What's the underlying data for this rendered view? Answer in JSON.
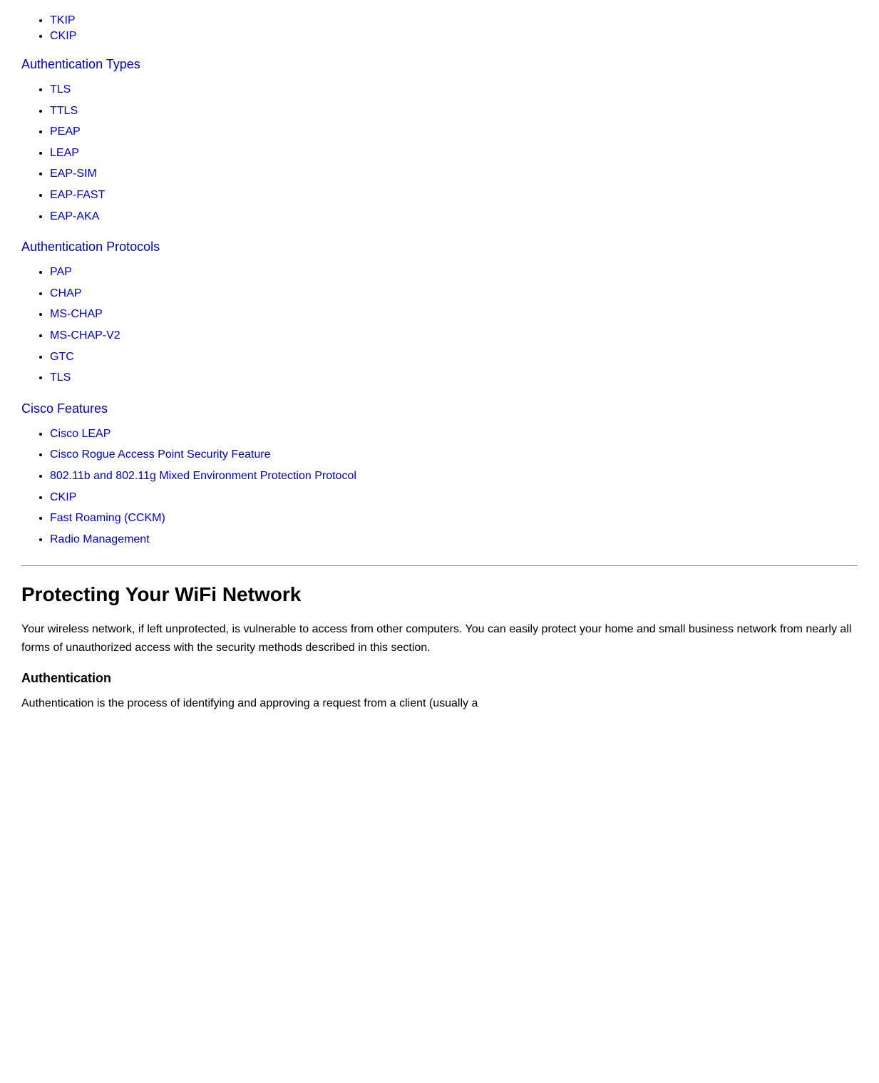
{
  "top_list": {
    "items": [
      {
        "label": "TKIP",
        "href": "#"
      },
      {
        "label": "CKIP",
        "href": "#"
      }
    ]
  },
  "sections": [
    {
      "heading": "Authentication Types",
      "heading_href": "#",
      "items": [
        {
          "label": "TLS",
          "href": "#"
        },
        {
          "label": "TTLS",
          "href": "#"
        },
        {
          "label": "PEAP",
          "href": "#"
        },
        {
          "label": "LEAP",
          "href": "#"
        },
        {
          "label": "EAP-SIM",
          "href": "#"
        },
        {
          "label": "EAP-FAST",
          "href": "#"
        },
        {
          "label": "EAP-AKA",
          "href": "#"
        }
      ]
    },
    {
      "heading": "Authentication Protocols",
      "heading_href": "#",
      "items": [
        {
          "label": "PAP",
          "href": "#"
        },
        {
          "label": "CHAP",
          "href": "#"
        },
        {
          "label": "MS-CHAP",
          "href": "#"
        },
        {
          "label": "MS-CHAP-V2",
          "href": "#"
        },
        {
          "label": "GTC",
          "href": "#"
        },
        {
          "label": "TLS",
          "href": "#"
        }
      ]
    },
    {
      "heading": "Cisco Features",
      "heading_href": "#",
      "items": [
        {
          "label": "Cisco LEAP",
          "href": "#"
        },
        {
          "label": "Cisco Rogue Access Point Security Feature",
          "href": "#"
        },
        {
          "label": "802.11b and 802.11g Mixed Environment Protection Protocol",
          "href": "#"
        },
        {
          "label": "CKIP",
          "href": "#"
        },
        {
          "label": "Fast Roaming (CCKM)",
          "href": "#"
        },
        {
          "label": "Radio Management",
          "href": "#"
        }
      ]
    }
  ],
  "main": {
    "title": "Protecting Your WiFi Network",
    "intro_paragraph": "Your wireless network, if left unprotected, is vulnerable to access from other computers. You can easily protect your home and small business network from nearly all forms of unauthorized access with the security methods described in this section.",
    "sub_heading": "Authentication",
    "sub_paragraph": "Authentication is the process of identifying and approving a request from a client (usually a"
  }
}
